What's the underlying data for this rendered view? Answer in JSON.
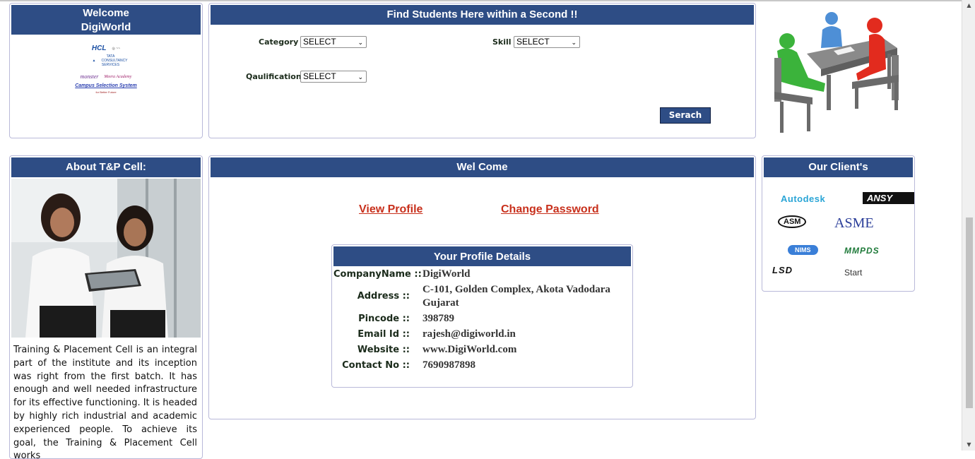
{
  "welcome_panel": {
    "title_line1": "Welcome",
    "title_line2": "DigiWorld",
    "logos": {
      "hcl": "HCL",
      "tcs": "TATA CONSULTANCY SERVICES",
      "monster": "monster",
      "meera": "Meera Academy",
      "css": "Campus Selection System",
      "css_sub": "for Better Future"
    }
  },
  "find_panel": {
    "title": "Find Students Here within a Second !!",
    "category_label": "Category :",
    "category_value": "SELECT",
    "skill_label": "Skill :",
    "skill_value": "SELECT",
    "qualification_label": "Qaulification :",
    "qualification_value": "SELECT",
    "search_button": "Serach"
  },
  "about_panel": {
    "title": "About T&P Cell:",
    "text": "Training & Placement Cell is an integral part of the institute and its inception was right from the first batch. It has enough and well needed infrastructure for its effective functioning. It is headed by highly rich industrial and academic experienced people. To achieve its goal, the Training & Placement Cell works"
  },
  "welcome_center": {
    "title": "Wel Come",
    "view_profile": "View Profile",
    "change_password": "Change Password"
  },
  "profile": {
    "title": "Your Profile Details",
    "fields": [
      {
        "label": "CompanyName ::",
        "value": "DigiWorld"
      },
      {
        "label": "Address ::",
        "value": "C-101, Golden Complex, Akota  Vadodara  Gujarat"
      },
      {
        "label": "Pincode ::",
        "value": "398789"
      },
      {
        "label": "Email Id ::",
        "value": "rajesh@digiworld.in"
      },
      {
        "label": "Website ::",
        "value": "www.DigiWorld.com"
      },
      {
        "label": "Contact No ::",
        "value": "7690987898"
      }
    ]
  },
  "clients_panel": {
    "title": "Our Client's",
    "clients": [
      "Autodesk",
      "ANSY",
      "ASM",
      "ASME",
      "NIMS",
      "MMPDS",
      "LSD",
      "Start"
    ]
  },
  "colors": {
    "header_bg": "#2e4d85",
    "link_red": "#c8301c",
    "panel_border": "#b9b9d9"
  }
}
